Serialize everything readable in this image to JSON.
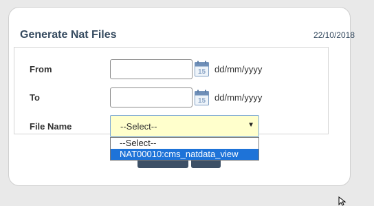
{
  "form": {
    "title": "Generate Nat Files",
    "date": "22/10/2018",
    "from_label": "From",
    "to_label": "To",
    "file_name_label": "File Name",
    "date_format_hint": "dd/mm/yyyy",
    "calendar_icon": "calendar-15-icon",
    "from_value": "",
    "to_value": "",
    "file_name_selected": "--Select--",
    "dropdown_options": [
      {
        "label": "--Select--",
        "highlighted": false
      },
      {
        "label": "NAT00010:cms_natdata_view",
        "highlighted": true
      }
    ]
  },
  "colors": {
    "title": "#354a5f",
    "select_bg": "#ffffcc",
    "highlight": "#1e73d8",
    "button": "#3d5066"
  }
}
